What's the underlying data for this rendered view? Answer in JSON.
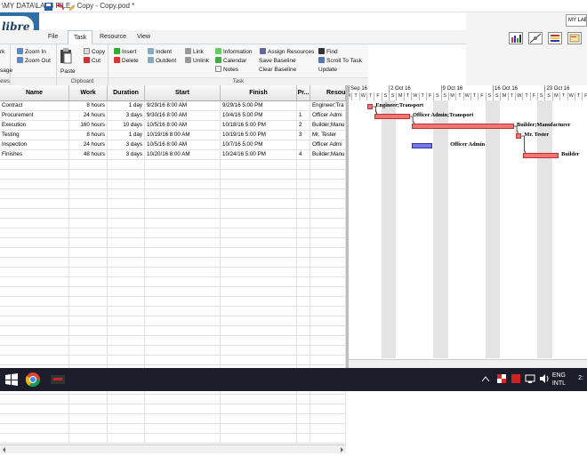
{
  "window": {
    "title": "\\MY DATA\\LAB3 FILE - Copy - Copy.pod *"
  },
  "logo": {
    "text": "libre"
  },
  "menu": {
    "items": [
      "File",
      "Task",
      "Resource",
      "View"
    ],
    "active": "Task"
  },
  "right": {
    "mode_box": "MY LAB"
  },
  "ribbon": {
    "views": {
      "label": "ews",
      "items": [
        "rk",
        "sage"
      ]
    },
    "zoom": {
      "zoom_in": "Zoom In",
      "zoom_out": "Zoom Out"
    },
    "clipboard": {
      "label": "Clipboard",
      "paste": "Paste",
      "copy": "Copy",
      "cut": "Cut"
    },
    "task": {
      "label": "Task",
      "insert": "Insert",
      "delete": "Delete",
      "indent": "Indent",
      "outdent": "Outdent",
      "link": "Link",
      "unlink": "Unlink",
      "information": "Information",
      "calendar": "Calendar",
      "notes": "Notes",
      "assign_resources": "Assign Resources",
      "save_baseline": "Save Baseline",
      "clear_baseline": "Clear Baseline",
      "find": "Find",
      "scroll_to_task": "Scroll To Task",
      "update": "Update"
    }
  },
  "table": {
    "headers": [
      "Name",
      "Work",
      "Duration",
      "Start",
      "Finish",
      "Pr...",
      "Resou"
    ],
    "rows": [
      {
        "name": "Contract",
        "work": "8 hours",
        "duration": "1 day",
        "start": "9/29/16 8:00 AM",
        "finish": "9/29/16 5:00 PM",
        "pred": "",
        "res": "Engineer;Tra"
      },
      {
        "name": "Procurement",
        "work": "24 hours",
        "duration": "3 days",
        "start": "9/30/16 8:00 AM",
        "finish": "10/4/16 5:00 PM",
        "pred": "1",
        "res": "Officer Admi"
      },
      {
        "name": "Execution",
        "work": "160 hours",
        "duration": "10 days",
        "start": "10/5/16 8:00 AM",
        "finish": "10/18/16 5:00 PM",
        "pred": "2",
        "res": "Builder;Manu"
      },
      {
        "name": "Testing",
        "work": "8 hours",
        "duration": "1 day",
        "start": "10/19/16 8:00 AM",
        "finish": "10/19/16 5:00 PM",
        "pred": "3",
        "res": "Mr. Tester"
      },
      {
        "name": "Inspection",
        "work": "24 hours",
        "duration": "3 days",
        "start": "10/5/16 8:00 AM",
        "finish": "10/7/16 5:00 PM",
        "pred": "",
        "res": "Officer Admi"
      },
      {
        "name": "Finishes",
        "work": "48 hours",
        "duration": "3 days",
        "start": "10/20/16 8:00 AM",
        "finish": "10/24/16 5:00 PM",
        "pred": "4",
        "res": "Builder;Manu"
      }
    ]
  },
  "gantt": {
    "weeks": [
      "Sep 16",
      "2 Oct 16",
      "9 Oct 16",
      "16 Oct 16",
      "23 Oct 16"
    ],
    "day_letters": [
      "M",
      "T",
      "W",
      "T",
      "F",
      "S",
      "S"
    ],
    "bar_labels": [
      "Engineer;Transport",
      "Officer Admin;Transport",
      "Builder;Manufacturer",
      "Mr. Tester",
      "Officer Admin",
      "Builder"
    ]
  },
  "taskbar": {
    "lang": "ENG",
    "region": "INTL",
    "time": "2:"
  },
  "colors": {
    "bar": "#f07676",
    "bar_blue": "#7777ee",
    "logo": "#2e6fa8",
    "taskbar": "#1c1c2a"
  }
}
